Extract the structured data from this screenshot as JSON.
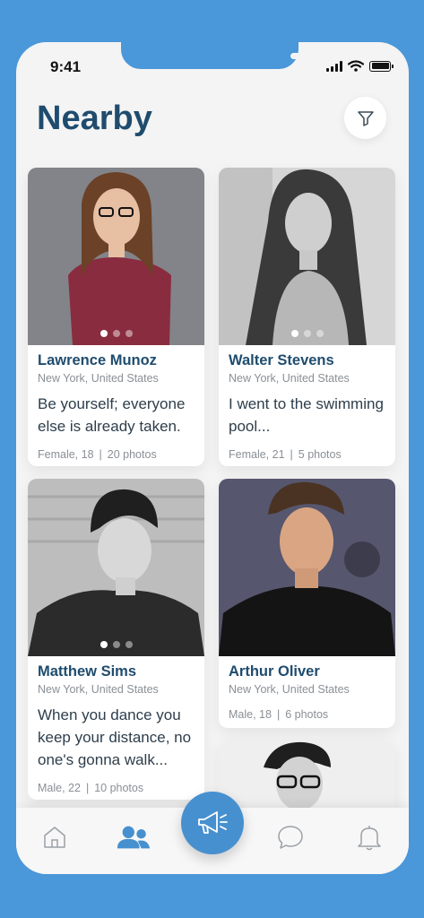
{
  "status": {
    "time": "9:41"
  },
  "header": {
    "title": "Nearby"
  },
  "colors": {
    "accent": "#4790cf",
    "title": "#1f4c6e",
    "background": "#4a97d9"
  },
  "icons": {
    "filter": "filter-icon",
    "home": "home-icon",
    "people": "people-icon",
    "megaphone": "megaphone-icon",
    "chat": "chat-icon",
    "bell": "bell-icon"
  },
  "profiles": [
    {
      "name": "Lawrence Munoz",
      "location": "New York, United States",
      "bio": "Be yourself; everyone else is already taken.",
      "gender_age": "Female, 18",
      "photos": "20 photos"
    },
    {
      "name": "Walter Stevens",
      "location": "New York, United States",
      "bio": "I went to the swimming pool...",
      "gender_age": "Female, 21",
      "photos": "5 photos"
    },
    {
      "name": "Matthew Sims",
      "location": "New York, United States",
      "bio": "When you dance you keep your distance, no one's gonna walk...",
      "gender_age": "Male, 22",
      "photos": "10 photos"
    },
    {
      "name": "Arthur Oliver",
      "location": "New York, United States",
      "gender_age": "Male, 18",
      "photos": "6 photos"
    }
  ],
  "separator": "|",
  "tabbar": {
    "active": "people"
  }
}
